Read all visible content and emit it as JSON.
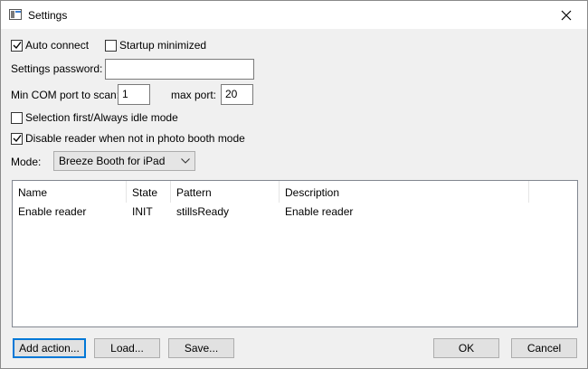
{
  "window": {
    "title": "Settings",
    "icon": "settings-app-icon"
  },
  "options": {
    "auto_connect": {
      "label": "Auto connect",
      "checked": true
    },
    "startup_minimized": {
      "label": "Startup minimized",
      "checked": false
    },
    "selection_first": {
      "label": "Selection first/Always idle mode",
      "checked": false
    },
    "disable_reader": {
      "label": "Disable reader when not in photo booth mode",
      "checked": true
    }
  },
  "password": {
    "label": "Settings password:",
    "value": ""
  },
  "com_ports": {
    "min_label": "Min COM port to scan:",
    "min_value": "1",
    "max_label": "max port:",
    "max_value": "20"
  },
  "mode": {
    "label": "Mode:",
    "selected": "Breeze Booth for iPad"
  },
  "actions_table": {
    "columns": [
      "Name",
      "State",
      "Pattern",
      "Description"
    ],
    "rows": [
      {
        "name": "Enable reader",
        "state": "INIT",
        "pattern": "stillsReady",
        "description": "Enable reader"
      }
    ]
  },
  "buttons": {
    "add_action": "Add action...",
    "load": "Load...",
    "save": "Save...",
    "ok": "OK",
    "cancel": "Cancel"
  }
}
